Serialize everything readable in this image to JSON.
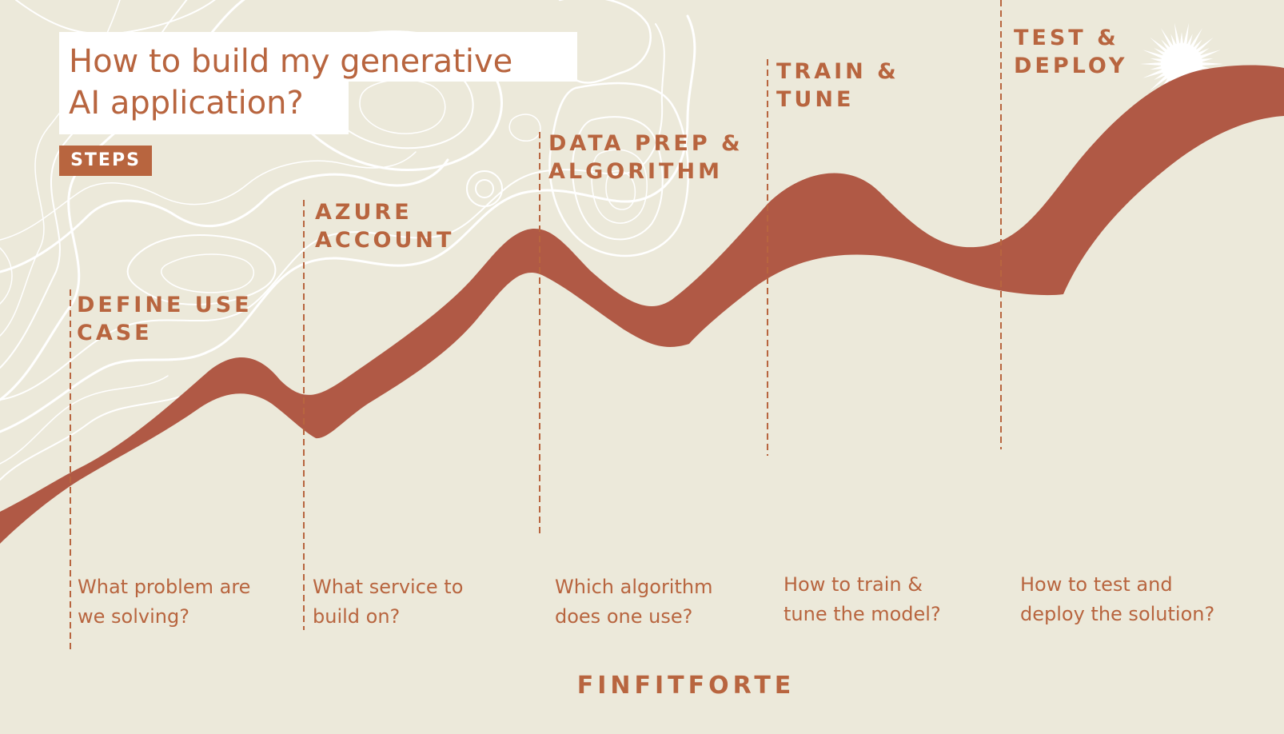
{
  "title": {
    "line1": "How to build my generative",
    "line2": "AI application?"
  },
  "badge": {
    "label": "STEPS"
  },
  "steps": [
    {
      "heading": "DEFINE USE\nCASE",
      "question": "What problem are\nwe solving?"
    },
    {
      "heading": "AZURE\nACCOUNT",
      "question": "What service to\nbuild on?"
    },
    {
      "heading": "DATA PREP &\nALGORITHM",
      "question": "Which algorithm\ndoes one use?"
    },
    {
      "heading": "TRAIN &\nTUNE",
      "question": "How to train &\ntune the model?"
    },
    {
      "heading": "TEST &\nDEPLOY",
      "question": "How to test and\ndeploy the solution?"
    }
  ],
  "footer": {
    "brand": "FINFITFORTE"
  },
  "icons": {
    "sun": "sun-burst-icon"
  },
  "colors": {
    "background": "#ECE9DA",
    "accent": "#B8653F",
    "ribbon": "#B05945",
    "contour": "#FFFFFF"
  }
}
